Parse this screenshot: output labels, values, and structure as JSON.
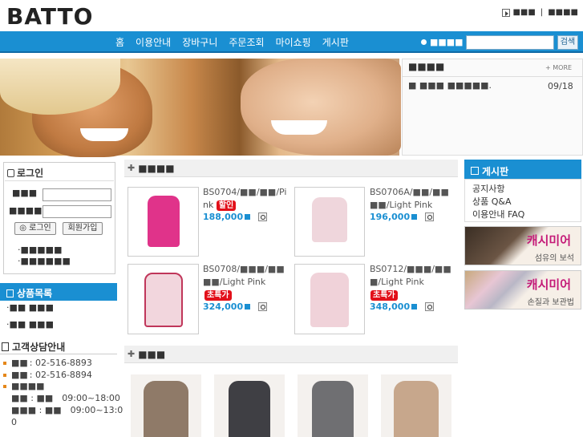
{
  "header": {
    "logo": "BATTO",
    "top_links": [
      "■■■",
      "■■■■"
    ]
  },
  "nav": {
    "items": [
      "홈",
      "이용안내",
      "장바구니",
      "주문조회",
      "마이쇼핑",
      "게시판"
    ]
  },
  "search": {
    "label": "■■■■",
    "value": "",
    "button": "검색"
  },
  "notice": {
    "title": "■■■■",
    "more": "MORE",
    "item_text": "■ ■■■ ■■■■■.",
    "item_date": "09/18"
  },
  "login": {
    "title": "로그인",
    "id_label": "■■■",
    "pw_label": "■■■■",
    "login_button": "로그인",
    "join_button": "회원가입",
    "find_links": [
      "■■■■■",
      "■■■■■■"
    ]
  },
  "category": {
    "title": "상품목록",
    "items": [
      "■■ ■■■",
      "■■ ■■■"
    ]
  },
  "customer_service": {
    "title": "고객상담안내",
    "rows": [
      {
        "label": "■■",
        "value": ": 02-516-8893"
      },
      {
        "label": "■■",
        "value": ": 02-516-8894"
      },
      {
        "label": "■■■■",
        "value": ""
      },
      {
        "label": "■■ : ■■",
        "value": "09:00~18:00"
      },
      {
        "label": "■■■ : ■■",
        "value": "09:00~13:0"
      },
      {
        "label": "",
        "value": "0"
      }
    ]
  },
  "section_new": {
    "title": "■■■■"
  },
  "section_best": {
    "title": "■■■"
  },
  "products": [
    {
      "name_line1": "BS0704/■■/■■/Pi",
      "name_line2": "nk",
      "badge": "할인",
      "price": "188,000",
      "color": "#e0338a"
    },
    {
      "name_line1": "BS0706A/■■/■■",
      "name_line2": "■■/Light Pink",
      "badge": "",
      "price": "196,000",
      "color": "#efd6dc"
    },
    {
      "name_line1": "BS0708/■■■/■■",
      "name_line2": "■■/Light Pink",
      "badge": "초특가",
      "price": "324,000",
      "color": "#f2d6dd"
    },
    {
      "name_line1": "BS0712/■■■/■■",
      "name_line2": "■/Light Pink",
      "badge": "초특가",
      "price": "348,000",
      "color": "#f0d2d9"
    }
  ],
  "best_products": [
    {
      "color": "#8f7a68"
    },
    {
      "color": "#3f3f44"
    },
    {
      "color": "#6f6f72"
    },
    {
      "color": "#c7a78c"
    }
  ],
  "board": {
    "title": "게시판",
    "items": [
      "공지사항",
      "상품 Q&A",
      "이용안내 FAQ"
    ]
  },
  "ads": [
    {
      "title": "캐시미어",
      "sub": "섬유의 보석"
    },
    {
      "title": "캐시미어",
      "sub": "손질과 보관법"
    }
  ]
}
